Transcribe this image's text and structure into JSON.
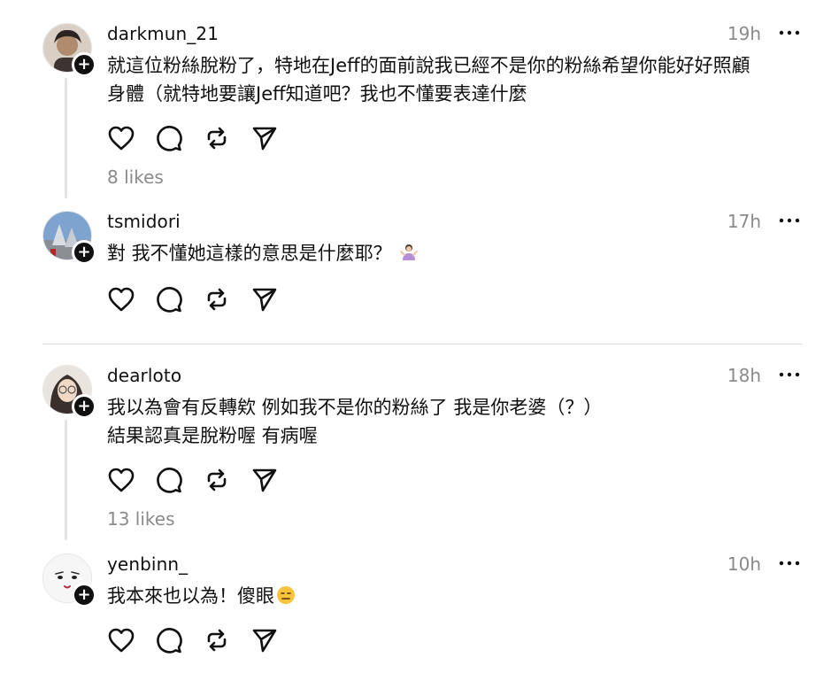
{
  "comments": [
    {
      "username": "darkmun_21",
      "time": "19h",
      "text_lines": [
        "就這位粉絲脫粉了，特地在Jeff的面前說我已經不是你的粉絲希望你能好好照顧",
        "身體（就特地要讓Jeff知道吧？我也不懂要表達什麼"
      ],
      "likes": "8 likes",
      "avatar_color": "#5a4a3f"
    },
    {
      "username": "tsmidori",
      "time": "17h",
      "text_lines": [
        "對 我不懂她這樣的意思是什麼耶？"
      ],
      "emoji": "person-shrugging-emoji",
      "likes": "",
      "avatar_color": "#6f8fb8"
    },
    {
      "username": "dearloto",
      "time": "18h",
      "text_lines": [
        "我以為會有反轉欸 例如我不是你的粉絲了 我是你老婆（？）",
        "結果認真是脫粉喔 有病喔"
      ],
      "likes": "13 likes",
      "avatar_color": "#c9b8a8"
    },
    {
      "username": "yenbinn_",
      "time": "10h",
      "text_lines": [
        "我本來也以為！傻眼"
      ],
      "emoji": "expressionless-face-emoji",
      "likes": "",
      "avatar_color": "#f2f2f2"
    }
  ],
  "icons": {
    "like": "heart-icon",
    "reply": "comment-bubble-icon",
    "repost": "repost-icon",
    "share": "send-icon",
    "more": "more-horizontal-icon",
    "follow": "plus-icon"
  },
  "colors": {
    "text": "#101010",
    "muted": "#8a8a8a",
    "line": "#e3e3e3"
  }
}
